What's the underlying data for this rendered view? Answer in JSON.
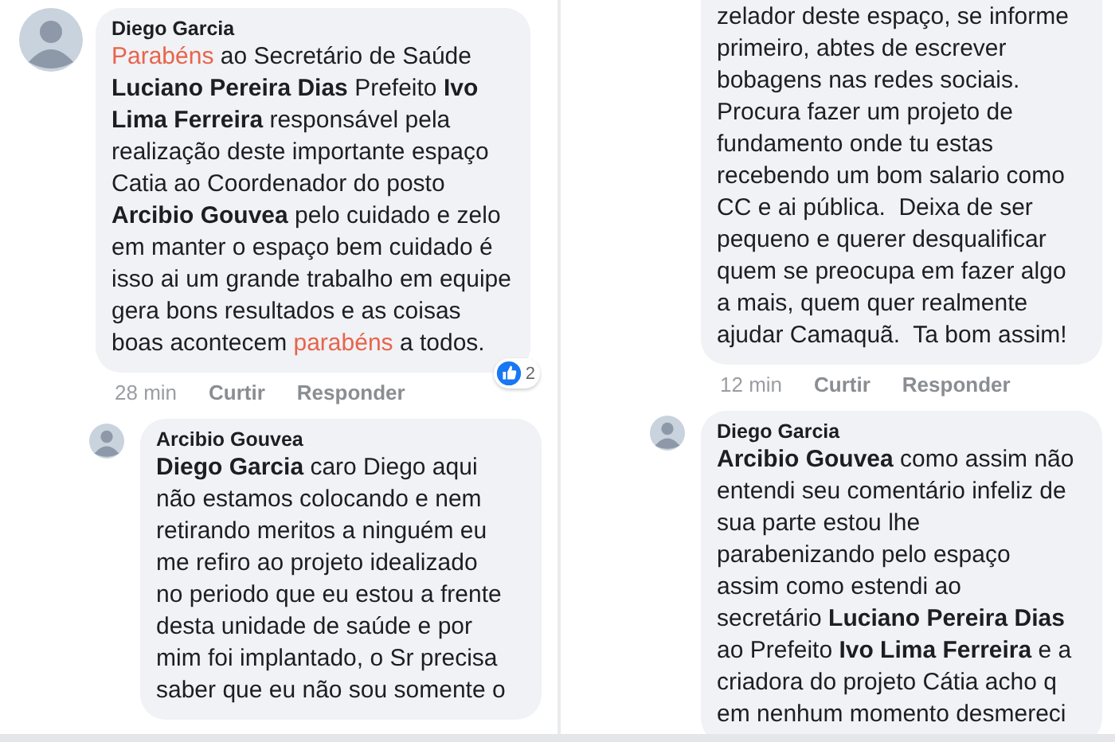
{
  "columns": [
    {
      "comments": [
        {
          "kind": "top",
          "avatar": true,
          "author": "Diego Garcia",
          "lines": [
            [
              {
                "kind": "highlight",
                "text": "Parabéns"
              },
              {
                "kind": "plain",
                "text": " ao Secretário de Saúde"
              }
            ],
            [
              {
                "kind": "bold",
                "text": "Luciano Pereira Dias"
              },
              {
                "kind": "plain",
                "text": " Prefeito "
              },
              {
                "kind": "bold",
                "text": "Ivo"
              }
            ],
            [
              {
                "kind": "bold",
                "text": "Lima Ferreira"
              },
              {
                "kind": "plain",
                "text": " responsável pela"
              }
            ],
            [
              {
                "kind": "plain",
                "text": "realização deste importante espaço"
              }
            ],
            [
              {
                "kind": "plain",
                "text": "Catia ao Coordenador do posto"
              }
            ],
            [
              {
                "kind": "bold",
                "text": "Arcibio Gouvea"
              },
              {
                "kind": "plain",
                "text": " pelo cuidado e zelo"
              }
            ],
            [
              {
                "kind": "plain",
                "text": "em manter o espaço bem cuidado é"
              }
            ],
            [
              {
                "kind": "plain",
                "text": "isso ai um grande trabalho em equipe"
              }
            ],
            [
              {
                "kind": "plain",
                "text": "gera bons resultados e as coisas"
              }
            ],
            [
              {
                "kind": "plain",
                "text": "boas acontecem "
              },
              {
                "kind": "highlight",
                "text": "parabéns"
              },
              {
                "kind": "plain",
                "text": " a todos."
              }
            ]
          ],
          "time": "28 min",
          "like": "Curtir",
          "reply": "Responder",
          "reactions": "2"
        },
        {
          "kind": "reply",
          "avatar": true,
          "author": "Arcibio Gouvea",
          "lines": [
            [
              {
                "kind": "bold",
                "text": "Diego Garcia"
              },
              {
                "kind": "plain",
                "text": " caro Diego aqui"
              }
            ],
            [
              {
                "kind": "plain",
                "text": "não estamos colocando e nem"
              }
            ],
            [
              {
                "kind": "plain",
                "text": "retirando meritos a ninguém eu"
              }
            ],
            [
              {
                "kind": "plain",
                "text": "me refiro ao projeto idealizado"
              }
            ],
            [
              {
                "kind": "plain",
                "text": "no periodo que eu estou a frente"
              }
            ],
            [
              {
                "kind": "plain",
                "text": "desta unidade de saúde e por"
              }
            ],
            [
              {
                "kind": "plain",
                "text": "mim foi implantado, o Sr precisa"
              }
            ],
            [
              {
                "kind": "plain",
                "text": "saber que eu não sou somente o"
              }
            ]
          ]
        }
      ]
    },
    {
      "comments": [
        {
          "kind": "reply",
          "avatar": false,
          "lines": [
            [
              {
                "kind": "plain",
                "text": "zelador deste espaço, se informe"
              }
            ],
            [
              {
                "kind": "plain",
                "text": "primeiro, abtes de escrever"
              }
            ],
            [
              {
                "kind": "plain",
                "text": "bobagens nas redes sociais."
              }
            ],
            [
              {
                "kind": "plain",
                "text": "Procura fazer um projeto de"
              }
            ],
            [
              {
                "kind": "plain",
                "text": "fundamento onde tu estas"
              }
            ],
            [
              {
                "kind": "plain",
                "text": "recebendo um bom salario como"
              }
            ],
            [
              {
                "kind": "plain",
                "text": "CC e ai pública.  Deixa de ser"
              }
            ],
            [
              {
                "kind": "plain",
                "text": "pequeno e querer desqualificar"
              }
            ],
            [
              {
                "kind": "plain",
                "text": "quem se preocupa em fazer algo"
              }
            ],
            [
              {
                "kind": "plain",
                "text": "a mais, quem quer realmente"
              }
            ],
            [
              {
                "kind": "plain",
                "text": "ajudar Camaquã.  Ta bom assim!"
              }
            ]
          ],
          "time": "12 min",
          "like": "Curtir",
          "reply": "Responder"
        },
        {
          "kind": "reply",
          "avatar": true,
          "author": "Diego Garcia",
          "lines": [
            [
              {
                "kind": "bold",
                "text": "Arcibio Gouvea"
              },
              {
                "kind": "plain",
                "text": " como assim não"
              }
            ],
            [
              {
                "kind": "plain",
                "text": "entendi seu comentário infeliz de"
              }
            ],
            [
              {
                "kind": "plain",
                "text": "sua parte estou lhe"
              }
            ],
            [
              {
                "kind": "plain",
                "text": "parabenizando pelo espaço"
              }
            ],
            [
              {
                "kind": "plain",
                "text": "assim como estendi ao"
              }
            ],
            [
              {
                "kind": "plain",
                "text": "secretário "
              },
              {
                "kind": "bold",
                "text": "Luciano Pereira Dias"
              }
            ],
            [
              {
                "kind": "plain",
                "text": "ao Prefeito "
              },
              {
                "kind": "bold",
                "text": "Ivo Lima Ferreira"
              },
              {
                "kind": "plain",
                "text": " e a"
              }
            ],
            [
              {
                "kind": "plain",
                "text": "criadora do projeto Cátia acho q"
              }
            ],
            [
              {
                "kind": "plain",
                "text": "em nenhum momento desmereci"
              }
            ]
          ]
        }
      ]
    }
  ]
}
